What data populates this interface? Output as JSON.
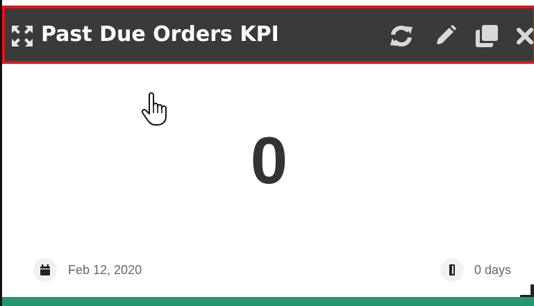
{
  "widget": {
    "title": "Past Due Orders KPI",
    "kpi_value": "0",
    "date": "Feb 12, 2020",
    "duration": "0 days",
    "header_icons": [
      "expand-icon",
      "refresh-icon",
      "pencil-icon",
      "clone-icon",
      "close-icon"
    ],
    "footer_color": "#27966e",
    "header_bg": "#3a3a3a",
    "header_border": "#e5121b"
  }
}
